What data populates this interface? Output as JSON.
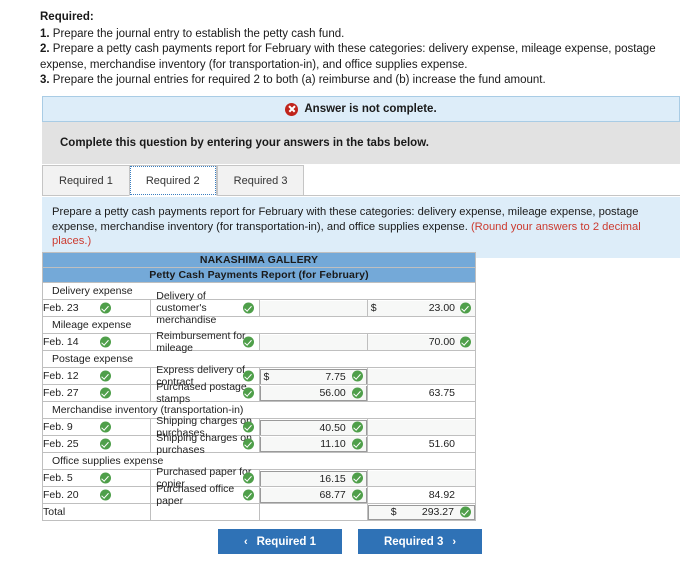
{
  "required": {
    "title": "Required:",
    "items": [
      {
        "num": "1.",
        "text": "Prepare the journal entry to establish the petty cash fund."
      },
      {
        "num": "2.",
        "text": "Prepare a petty cash payments report for February with these categories: delivery expense, mileage expense, postage expense, merchandise inventory (for transportation-in), and office supplies expense."
      },
      {
        "num": "3.",
        "text": "Prepare the journal entries for required 2 to both (a) reimburse and (b) increase the fund amount."
      }
    ]
  },
  "alert": {
    "icon": "error-circle-icon",
    "text": "Answer is not complete.",
    "bg": "#ddedf9",
    "border": "#a9cce5",
    "icon_color": "#c0241c"
  },
  "instruction_strip": {
    "text": "Complete this question by entering your answers in the tabs below.",
    "bg": "#e2e2e2"
  },
  "tabs": [
    {
      "label": "Required 1",
      "active": false
    },
    {
      "label": "Required 2",
      "active": true
    },
    {
      "label": "Required 3",
      "active": false
    }
  ],
  "prompt": {
    "text": "Prepare a petty cash payments report for February with these categories: delivery expense, mileage expense, postage expense, merchandise inventory (for transportation-in), and office supplies expense. ",
    "note": "(Round your answers to 2 decimal places.)",
    "note_color": "#cc3b30",
    "bg": "#ddedf9"
  },
  "report": {
    "company": "NAKASHIMA GALLERY",
    "subtitle": "Petty Cash Payments Report (for February)",
    "header_bg": "#74a9d8",
    "check_color": "#4f9f4a",
    "sections": [
      {
        "category": "Delivery expense",
        "rows": [
          {
            "date": "Feb. 23",
            "date_ok": true,
            "desc": "Delivery of customer's merchandise",
            "desc_ok": true,
            "amount1": "",
            "amount1_dollar": false,
            "amount1_ok": false,
            "amount2": "23.00",
            "amount2_dollar": true,
            "amount2_ok": true
          }
        ]
      },
      {
        "category": "Mileage expense",
        "rows": [
          {
            "date": "Feb. 14",
            "date_ok": true,
            "desc": "Reimbursement for mileage",
            "desc_ok": true,
            "amount1": "",
            "amount1_dollar": false,
            "amount1_ok": false,
            "amount2": "70.00",
            "amount2_dollar": false,
            "amount2_ok": true
          }
        ]
      },
      {
        "category": "Postage expense",
        "rows": [
          {
            "date": "Feb. 12",
            "date_ok": true,
            "desc": "Express delivery of contract",
            "desc_ok": true,
            "amount1": "7.75",
            "amount1_dollar": true,
            "amount1_ok": true,
            "amount2": "",
            "amount2_dollar": false,
            "amount2_ok": false
          },
          {
            "date": "Feb. 27",
            "date_ok": true,
            "desc": "Purchased postage stamps",
            "desc_ok": true,
            "amount1": "56.00",
            "amount1_dollar": false,
            "amount1_ok": true,
            "amount2": "63.75",
            "amount2_dollar": false,
            "amount2_ok": false
          }
        ]
      },
      {
        "category": "Merchandise inventory (transportation-in)",
        "rows": [
          {
            "date": "Feb. 9",
            "date_ok": true,
            "desc": "Shipping charges on purchases",
            "desc_ok": true,
            "amount1": "40.50",
            "amount1_dollar": false,
            "amount1_ok": true,
            "amount2": "",
            "amount2_dollar": false,
            "amount2_ok": false
          },
          {
            "date": "Feb. 25",
            "date_ok": true,
            "desc": "Shipping charges on purchases",
            "desc_ok": true,
            "amount1": "11.10",
            "amount1_dollar": false,
            "amount1_ok": true,
            "amount2": "51.60",
            "amount2_dollar": false,
            "amount2_ok": false
          }
        ]
      },
      {
        "category": "Office supplies expense",
        "rows": [
          {
            "date": "Feb. 5",
            "date_ok": true,
            "desc": "Purchased paper for copier",
            "desc_ok": true,
            "amount1": "16.15",
            "amount1_dollar": false,
            "amount1_ok": true,
            "amount2": "",
            "amount2_dollar": false,
            "amount2_ok": false
          },
          {
            "date": "Feb. 20",
            "date_ok": true,
            "desc": "Purchased office paper",
            "desc_ok": true,
            "amount1": "68.77",
            "amount1_dollar": false,
            "amount1_ok": true,
            "amount2": "84.92",
            "amount2_dollar": false,
            "amount2_ok": false
          }
        ]
      }
    ],
    "total": {
      "label": "Total",
      "amount": "293.27",
      "dollar": "$",
      "ok": true
    }
  },
  "nav": {
    "prev": {
      "label": "Required 1",
      "caret": "‹"
    },
    "next": {
      "label": "Required 3",
      "caret": "›"
    },
    "color": "#2f72b6"
  }
}
